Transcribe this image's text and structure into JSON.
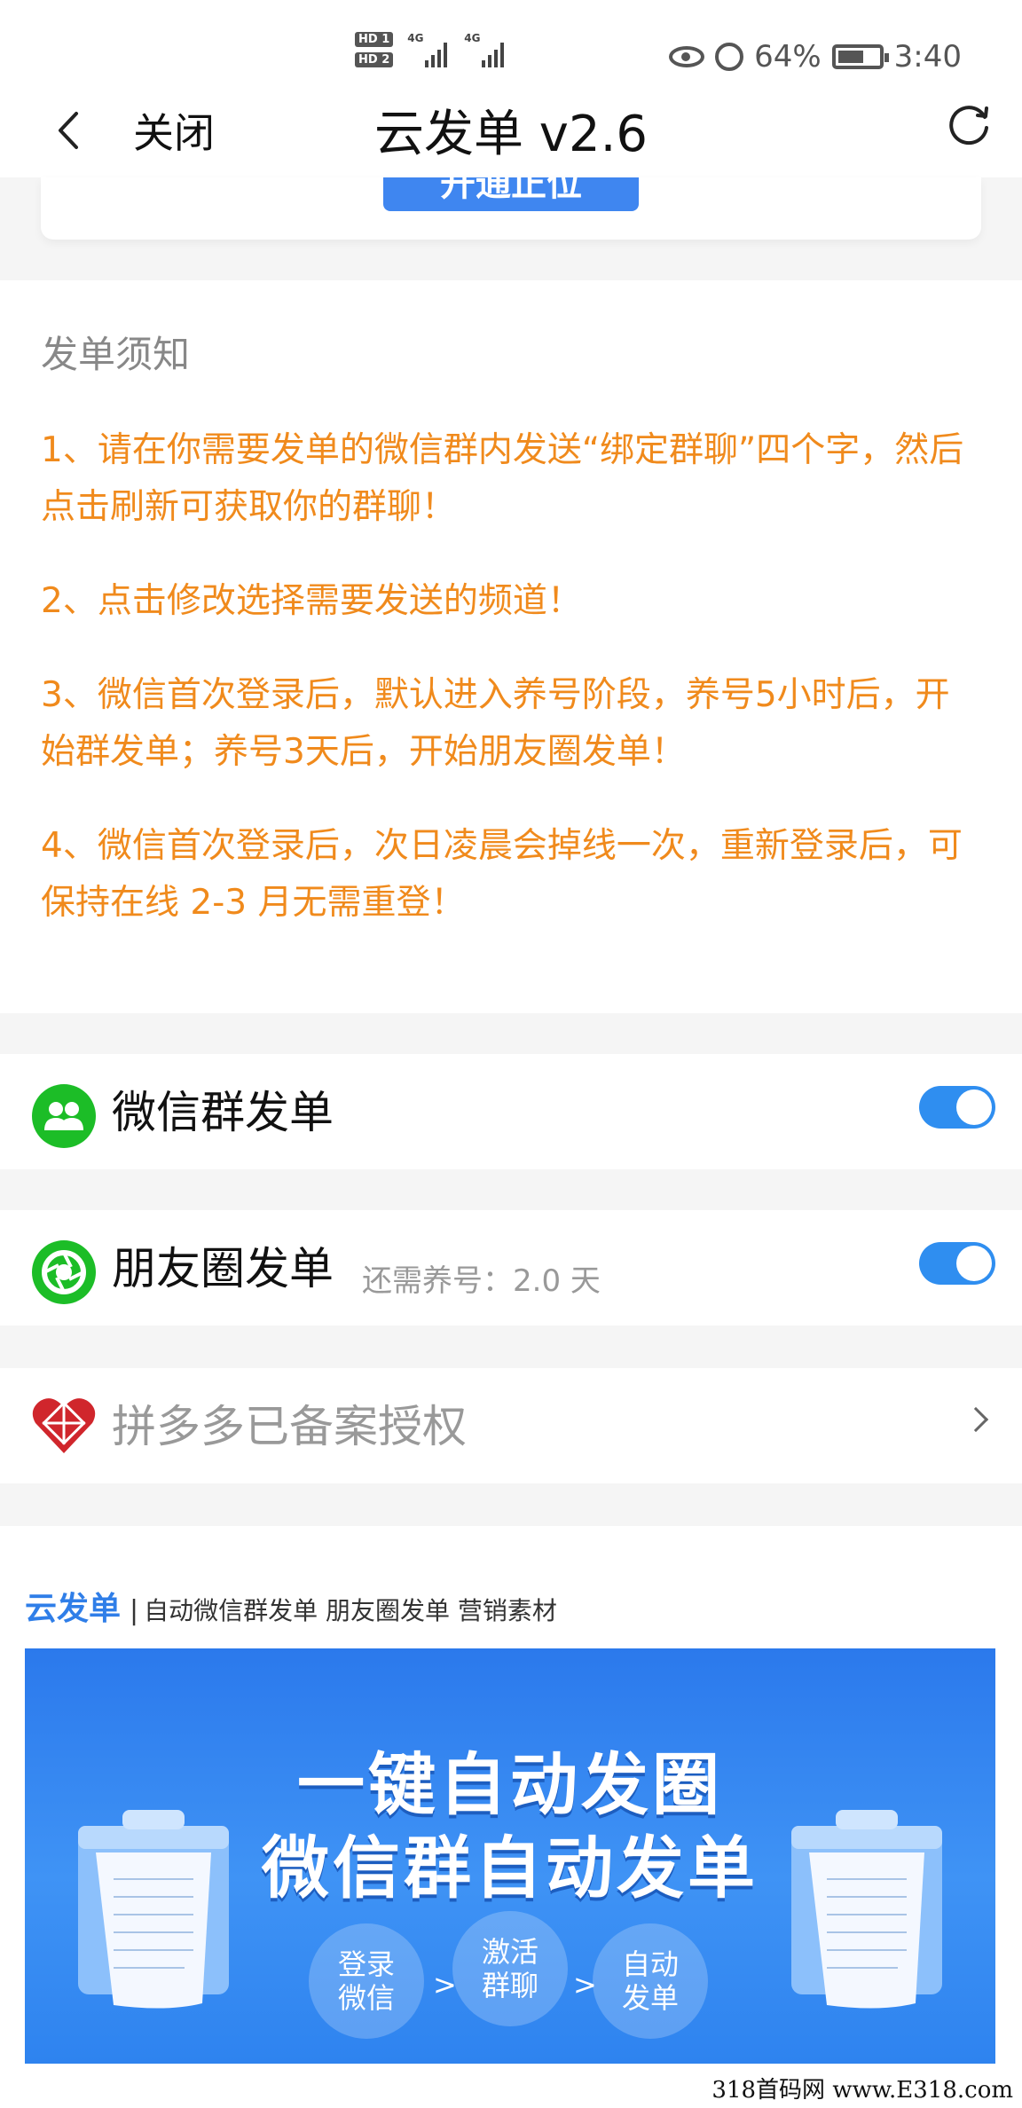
{
  "status_bar": {
    "battery": "64%",
    "time": "3:40",
    "sim1": "HD 1",
    "sim2": "HD 2",
    "net1": "4G",
    "net2": "4G"
  },
  "nav": {
    "close_label": "关闭",
    "title": "云发单 v2.6"
  },
  "partial_button": {
    "label": "开通正位"
  },
  "notice": {
    "title": "发单须知",
    "items": [
      "1、请在你需要发单的微信群内发送“绑定群聊”四个字，然后点击刷新可获取你的群聊！",
      "2、点击修改选择需要发送的频道！",
      "3、微信首次登录后，默认进入养号阶段，养号5小时后，开始群发单；养号3天后，开始朋友圈发单！",
      "4、微信首次登录后，次日凌晨会掉线一次，重新登录后，可保持在线 2-3 月无需重登！"
    ]
  },
  "rows": {
    "wechat_group": {
      "label": "微信群发单",
      "enabled": true
    },
    "moments": {
      "label": "朋友圈发单",
      "sub": "还需养号：2.0 天",
      "enabled": true
    },
    "pdd": {
      "label": "拼多多已备案授权"
    }
  },
  "promo": {
    "brand": "云发单",
    "separator": "|",
    "tagline": "自动微信群发单 朋友圈发单 营销素材",
    "banner_line1": "一键自动发圈",
    "banner_line2": "微信群自动发单",
    "steps": [
      "登录\n微信",
      "激活\n群聊",
      "自动\n发单"
    ],
    "arrow": ">"
  },
  "watermark": "318首码网 www.E318.com",
  "colors": {
    "accent": "#2f8ef0",
    "notice": "#f08a1c",
    "green": "#1cbd27",
    "pdd_red": "#d0262c"
  }
}
